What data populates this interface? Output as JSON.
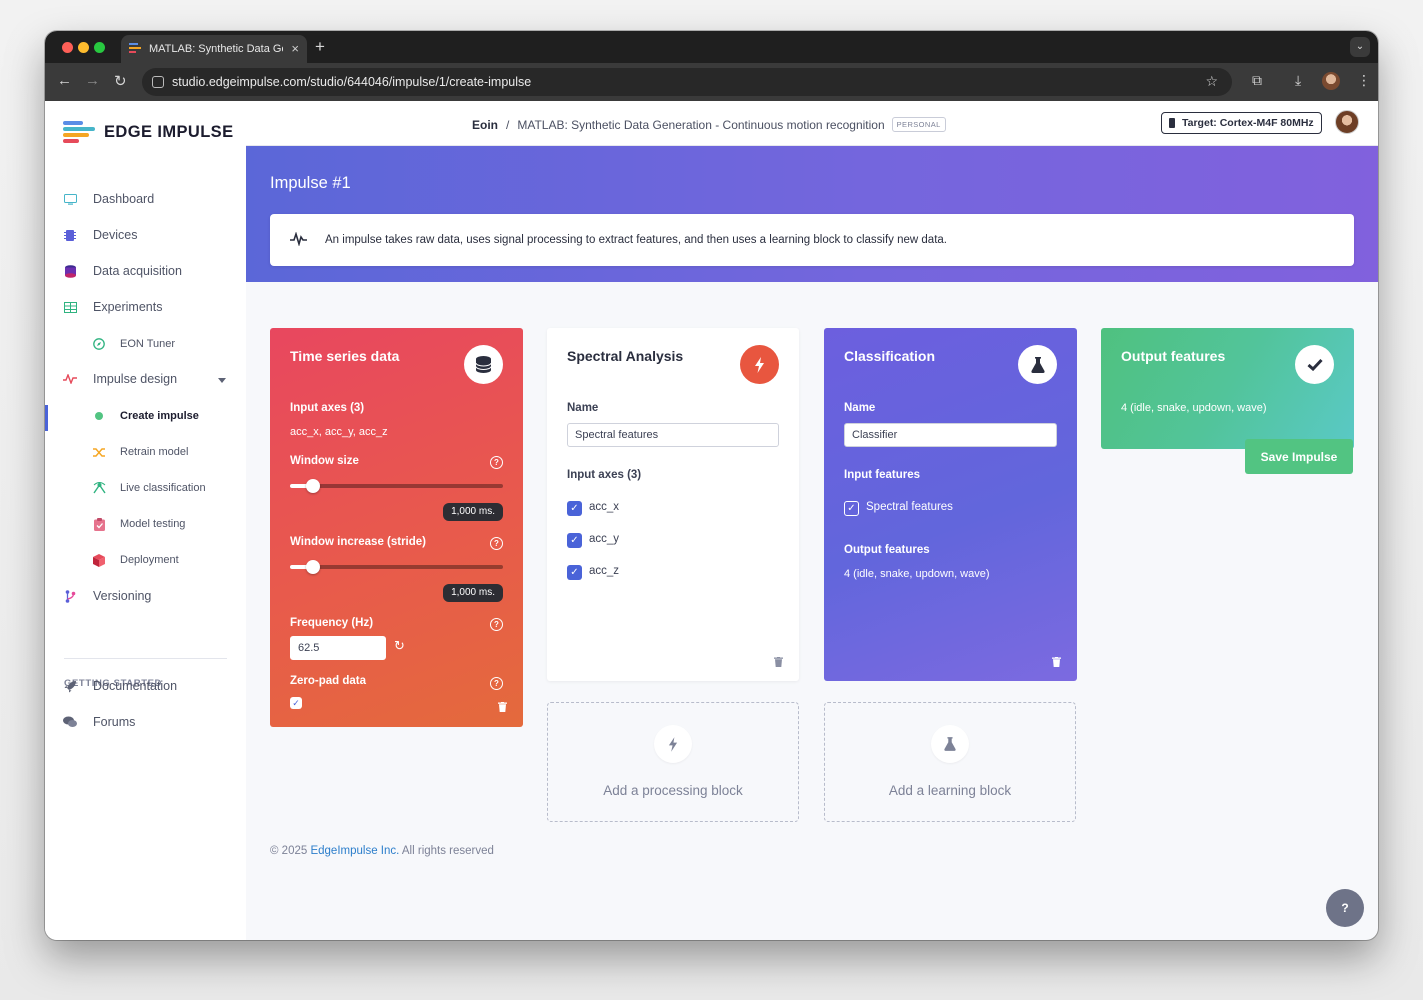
{
  "browser": {
    "tab_title": "MATLAB: Synthetic Data Gen",
    "url": "studio.edgeimpulse.com/studio/644046/impulse/1/create-impulse"
  },
  "brand": {
    "name": "EDGE IMPULSE"
  },
  "sidebar": {
    "items": [
      {
        "label": "Dashboard",
        "icon": "monitor-icon"
      },
      {
        "label": "Devices",
        "icon": "chip-icon"
      },
      {
        "label": "Data acquisition",
        "icon": "database-icon"
      },
      {
        "label": "Experiments",
        "icon": "table-icon"
      },
      {
        "label": "EON Tuner",
        "icon": "compass-icon"
      },
      {
        "label": "Impulse design",
        "icon": "pulse-icon"
      },
      {
        "label": "Create impulse",
        "icon": "dot-icon"
      },
      {
        "label": "Retrain model",
        "icon": "shuffle-icon"
      },
      {
        "label": "Live classification",
        "icon": "live-icon"
      },
      {
        "label": "Model testing",
        "icon": "clipboard-icon"
      },
      {
        "label": "Deployment",
        "icon": "cube-icon"
      },
      {
        "label": "Versioning",
        "icon": "branch-icon"
      }
    ],
    "getting_started_heading": "GETTING STARTED",
    "getting_started": [
      {
        "label": "Documentation",
        "icon": "rocket-icon"
      },
      {
        "label": "Forums",
        "icon": "chat-icon"
      }
    ]
  },
  "header": {
    "owner": "Eoin",
    "separator": "/",
    "project": "MATLAB: Synthetic Data Generation - Continuous motion recognition",
    "badge": "PERSONAL",
    "target": "Target: Cortex-M4F 80MHz"
  },
  "impulse": {
    "title": "Impulse #1",
    "info": "An impulse takes raw data, uses signal processing to extract features, and then uses a learning block to classify new data."
  },
  "time_series": {
    "title": "Time series data",
    "input_axes_label": "Input axes (3)",
    "input_axes_value": "acc_x, acc_y, acc_z",
    "window_size_label": "Window size",
    "window_size_value": "1,000 ms.",
    "window_size_fraction": 0.11,
    "stride_label": "Window increase (stride)",
    "stride_value": "1,000 ms.",
    "stride_fraction": 0.11,
    "frequency_label": "Frequency (Hz)",
    "frequency_value": "62.5",
    "zero_pad_label": "Zero-pad data",
    "zero_pad_checked": true
  },
  "spectral": {
    "title": "Spectral Analysis",
    "name_label": "Name",
    "name_value": "Spectral features",
    "axes_label": "Input axes (3)",
    "axes": [
      "acc_x",
      "acc_y",
      "acc_z"
    ]
  },
  "classification": {
    "title": "Classification",
    "name_label": "Name",
    "name_value": "Classifier",
    "input_features_label": "Input features",
    "input_feature": "Spectral features",
    "output_features_label": "Output features",
    "output_features_value": "4 (idle, snake, updown, wave)"
  },
  "output": {
    "title": "Output features",
    "value": "4 (idle, snake, updown, wave)"
  },
  "actions": {
    "add_processing": "Add a processing block",
    "add_learning": "Add a learning block",
    "save": "Save Impulse"
  },
  "footer": {
    "copyright": "© 2025",
    "company": "EdgeImpulse Inc.",
    "rights": "All rights reserved"
  },
  "colors": {
    "time_series_gradient": [
      "#e8475f",
      "#e46a3c"
    ],
    "classification_gradient": [
      "#6a60de",
      "#7b66e0"
    ],
    "output_gradient": [
      "#4fc17f",
      "#58c8c8"
    ],
    "accent_blue": "#4a63d8",
    "save_green": "#52c482"
  }
}
